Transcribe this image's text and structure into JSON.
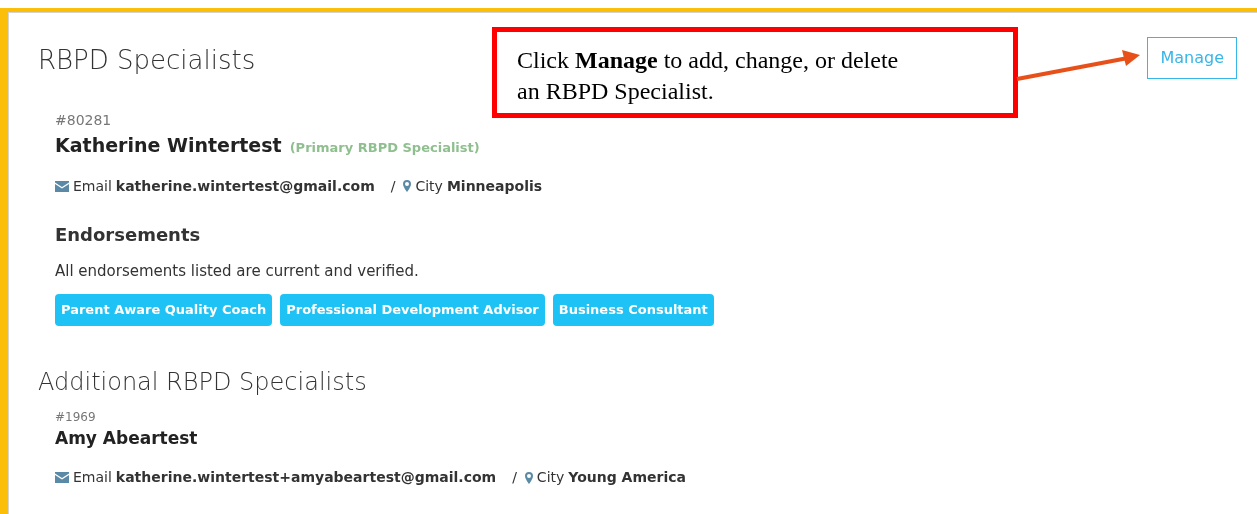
{
  "primary": {
    "title": "RBPD Specialists",
    "manage_button": "Manage",
    "specialist": {
      "id": "#80281",
      "name": "Katherine Wintertest",
      "role": "(Primary RBPD Specialist)",
      "email_label": "Email",
      "email": "katherine.wintertest@gmail.com",
      "separator": "/",
      "city_label": "City",
      "city": "Minneapolis"
    },
    "endorsements": {
      "title": "Endorsements",
      "note": "All endorsements listed are current and verified.",
      "tags": [
        "Parent Aware Quality Coach",
        "Professional Development Advisor",
        "Business Consultant"
      ]
    }
  },
  "additional": {
    "title": "Additional RBPD Specialists",
    "specialists": [
      {
        "id": "#1969",
        "name": "Amy Abeartest",
        "email_label": "Email",
        "email": "katherine.wintertest+amyabeartest@gmail.com",
        "separator": "/",
        "city_label": "City",
        "city": "Young America"
      }
    ]
  },
  "callout": {
    "text": "Click **Manage** to add, change, or delete an RBPD Specialist."
  }
}
